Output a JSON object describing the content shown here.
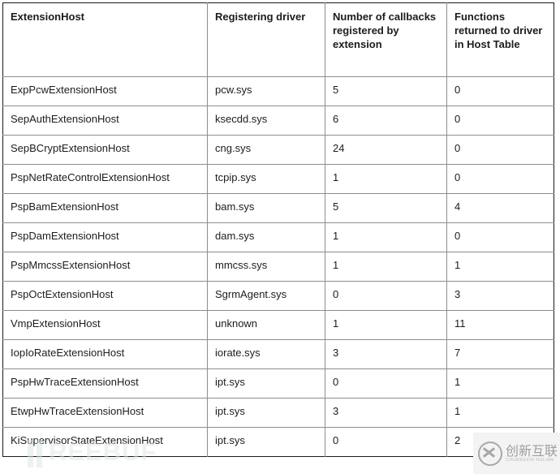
{
  "table": {
    "headers": [
      "ExtensionHost",
      "Registering driver",
      "Number of callbacks registered by extension",
      "Functions returned to driver in Host Table"
    ],
    "rows": [
      {
        "extension_host": "ExpPcwExtensionHost",
        "registering_driver": "pcw.sys",
        "callbacks_registered": "5",
        "functions_returned": "0"
      },
      {
        "extension_host": "SepAuthExtensionHost",
        "registering_driver": "ksecdd.sys",
        "callbacks_registered": "6",
        "functions_returned": "0"
      },
      {
        "extension_host": "SepBCryptExtensionHost",
        "registering_driver": "cng.sys",
        "callbacks_registered": "24",
        "functions_returned": "0"
      },
      {
        "extension_host": "PspNetRateControlExtensionHost",
        "registering_driver": "tcpip.sys",
        "callbacks_registered": "1",
        "functions_returned": "0"
      },
      {
        "extension_host": "PspBamExtensionHost",
        "registering_driver": "bam.sys",
        "callbacks_registered": "5",
        "functions_returned": "4"
      },
      {
        "extension_host": "PspDamExtensionHost",
        "registering_driver": "dam.sys",
        "callbacks_registered": "1",
        "functions_returned": "0"
      },
      {
        "extension_host": "PspMmcssExtensionHost",
        "registering_driver": "mmcss.sys",
        "callbacks_registered": "1",
        "functions_returned": "1"
      },
      {
        "extension_host": "PspOctExtensionHost",
        "registering_driver": "SgrmAgent.sys",
        "callbacks_registered": "0",
        "functions_returned": "3"
      },
      {
        "extension_host": "VmpExtensionHost",
        "registering_driver": "unknown",
        "callbacks_registered": "1",
        "functions_returned": "11"
      },
      {
        "extension_host": "IopIoRateExtensionHost",
        "registering_driver": "iorate.sys",
        "callbacks_registered": "3",
        "functions_returned": "7"
      },
      {
        "extension_host": "PspHwTraceExtensionHost",
        "registering_driver": "ipt.sys",
        "callbacks_registered": "0",
        "functions_returned": "1"
      },
      {
        "extension_host": "EtwpHwTraceExtensionHost",
        "registering_driver": "ipt.sys",
        "callbacks_registered": "3",
        "functions_returned": "1"
      },
      {
        "extension_host": "KiSupervisorStateExtensionHost",
        "registering_driver": "ipt.sys",
        "callbacks_registered": "0",
        "functions_returned": "2"
      }
    ]
  },
  "watermarks": {
    "freebuf": "REEBUF",
    "logo_cn": "创新互联",
    "logo_en": "CHUANGXIN HULIAN"
  },
  "colors": {
    "table_outer_border": "#1a1a1a",
    "table_inner_border": "#8d8d8d",
    "text": "#1c1c1c",
    "background": "#ffffff",
    "watermark_freebuf": "#dde9e3",
    "watermark_logo_bg": "#f3f3f3"
  }
}
